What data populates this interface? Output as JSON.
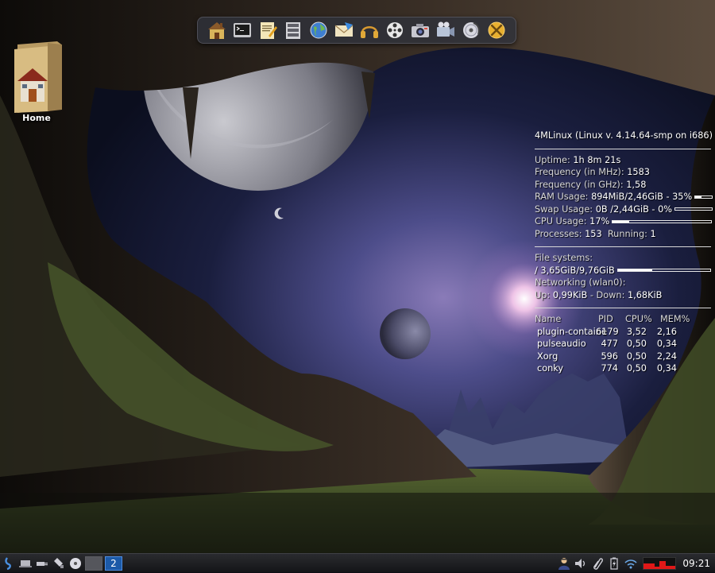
{
  "desktop": {
    "home_icon": {
      "label": "Home",
      "icon": "home-folder-icon"
    }
  },
  "dock": {
    "items": [
      {
        "id": "home",
        "icon": "home-icon"
      },
      {
        "id": "terminal",
        "icon": "terminal-icon"
      },
      {
        "id": "editor",
        "icon": "text-editor-icon"
      },
      {
        "id": "filemanager",
        "icon": "file-manager-icon"
      },
      {
        "id": "browser",
        "icon": "web-browser-icon"
      },
      {
        "id": "mail",
        "icon": "mail-icon"
      },
      {
        "id": "audio",
        "icon": "headphones-icon"
      },
      {
        "id": "video",
        "icon": "film-reel-icon"
      },
      {
        "id": "screenshot",
        "icon": "camera-icon"
      },
      {
        "id": "media",
        "icon": "video-camera-icon"
      },
      {
        "id": "burner",
        "icon": "disc-burner-icon"
      },
      {
        "id": "tools",
        "icon": "settings-tools-icon"
      }
    ]
  },
  "conky": {
    "header": "4MLinux (Linux v. 4.14.64-smp on i686)",
    "uptime_label": "Uptime:",
    "uptime_value": "1h 8m 21s",
    "freq_mhz_label": "Frequency (in MHz):",
    "freq_mhz_value": "1583",
    "freq_ghz_label": "Frequency (in GHz):",
    "freq_ghz_value": "1,58",
    "ram_label": "RAM Usage:",
    "ram_value": "894MiB/2,46GiB - 35%",
    "ram_percent": 35,
    "swap_label": "Swap Usage:",
    "swap_value": "0B  /2,44GiB - 0%",
    "swap_percent": 0,
    "cpu_label": "CPU Usage:",
    "cpu_value": "17%",
    "cpu_percent": 17,
    "processes_label": "Processes:",
    "processes_value": "153",
    "running_label": "Running:",
    "running_value": "1",
    "fs_label": "File systems:",
    "fs_value": " / 3,65GiB/9,76GiB",
    "fs_percent": 37,
    "net_label": "Networking (wlan0):",
    "up_label": "Up:",
    "up_value": "0,99KiB",
    "down_label": " - Down:",
    "down_value": "1,68KiB",
    "proc_headers": [
      "Name",
      "PID",
      "CPU%",
      "MEM%"
    ],
    "procs": [
      {
        "name": "plugin-containe",
        "pid": "6179",
        "cpu": "3,52",
        "mem": "2,16"
      },
      {
        "name": "pulseaudio",
        "pid": "477",
        "cpu": "0,50",
        "mem": "0,34"
      },
      {
        "name": "Xorg",
        "pid": "596",
        "cpu": "0,50",
        "mem": "2,24"
      },
      {
        "name": "conky",
        "pid": "774",
        "cpu": "0,50",
        "mem": "0,34"
      }
    ]
  },
  "taskbar": {
    "launchers": [
      "menu-icon",
      "laptop-icon",
      "plug-icon",
      "usb-icon",
      "disc-icon"
    ],
    "workspaces": [
      {
        "label": "",
        "active": false
      },
      {
        "label": "2",
        "active": true
      }
    ],
    "tray": [
      "user-icon",
      "volume-icon",
      "paperclip-icon",
      "battery-icon",
      "wifi-icon"
    ],
    "clock": "09:21"
  },
  "colors": {
    "accent": "#1c5aa8",
    "netgraph": "#e01818",
    "panel": "#1e1f23"
  }
}
